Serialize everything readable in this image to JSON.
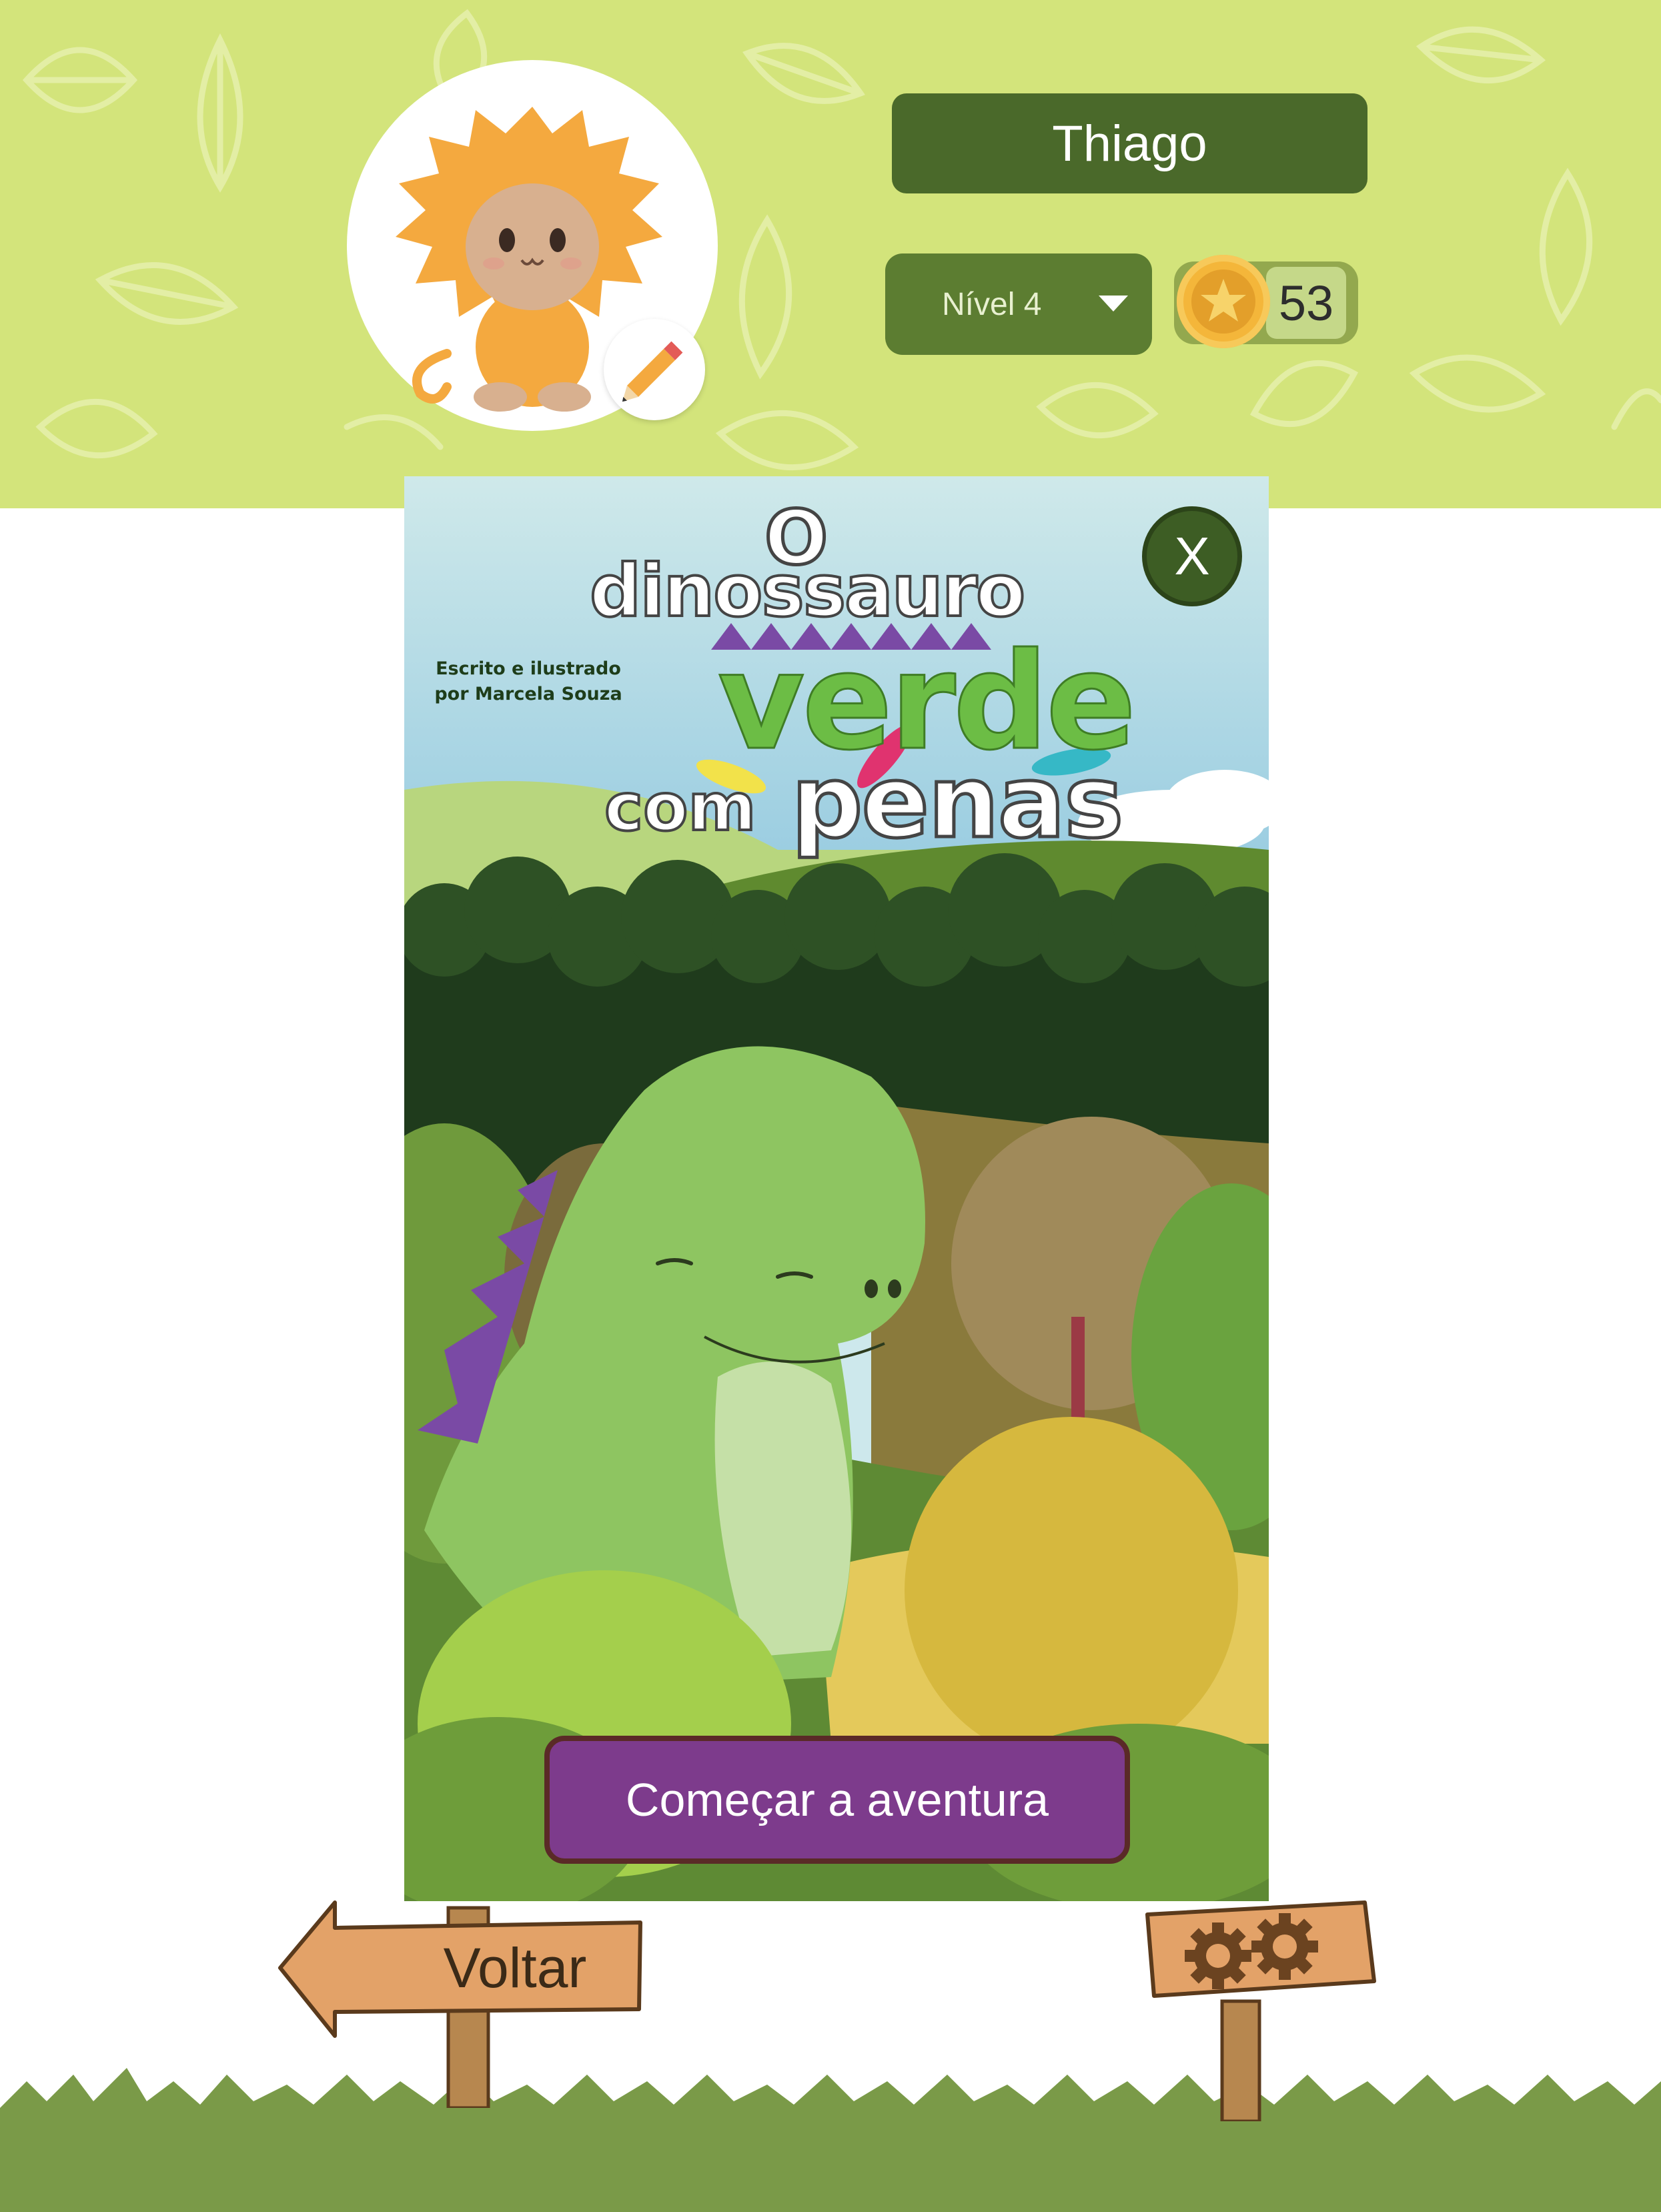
{
  "header": {
    "background_color": "#d3e47b",
    "avatar": {
      "icon": "monkey-avatar-icon",
      "edit_icon": "pencil-icon"
    },
    "player_name": "Thiago",
    "level": {
      "selected": "Nível 4",
      "icon": "chevron-down-icon"
    },
    "coins": {
      "icon": "star-coin-icon",
      "count": "53"
    }
  },
  "book": {
    "title_line1": "O",
    "title_line2": "dinossauro",
    "title_line3": "verde",
    "title_line4a": "com",
    "title_line4b": "penas",
    "author_line1": "Escrito e ilustrado",
    "author_line2": "por Marcela Souza",
    "close_label": "X",
    "start_button_label": "Começar a aventura"
  },
  "footer": {
    "back_label": "Voltar",
    "settings_icon": "gears-icon",
    "ground_color": "#7a9a48"
  }
}
